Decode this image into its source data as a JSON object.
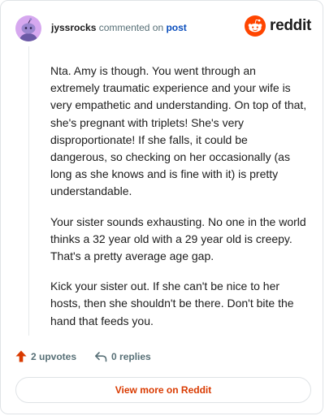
{
  "comment": {
    "username": "jyssrocks",
    "action_text": "commented on",
    "post_link": "post",
    "paragraphs": [
      "Nta. Amy is though. You went through an extremely traumatic experience and your wife is very empathetic and understanding. On top of that, she's pregnant with triplets! She's very disproportionate! If she falls, it could be dangerous, so checking on her occasionally (as long as she knows and is fine with it) is pretty understandable.",
      "Your sister sounds exhausting. No one in the world thinks a 32 year old with a 29 year old is creepy. That's a pretty average age gap.",
      "Kick your sister out. If she can't be nice to her hosts, then she shouldn't be there. Don't bite the hand that feeds you."
    ]
  },
  "brand": {
    "logo_text": "reddit",
    "accent_color": "#ff4500",
    "icon": "reddit-snoo-icon"
  },
  "actions": {
    "upvotes": "2 upvotes",
    "replies": "0 replies",
    "upvote_icon": "upvote-arrow-icon",
    "reply_icon": "reply-arrow-icon"
  },
  "footer": {
    "view_more": "View more on Reddit",
    "link_color": "#d93a00"
  }
}
